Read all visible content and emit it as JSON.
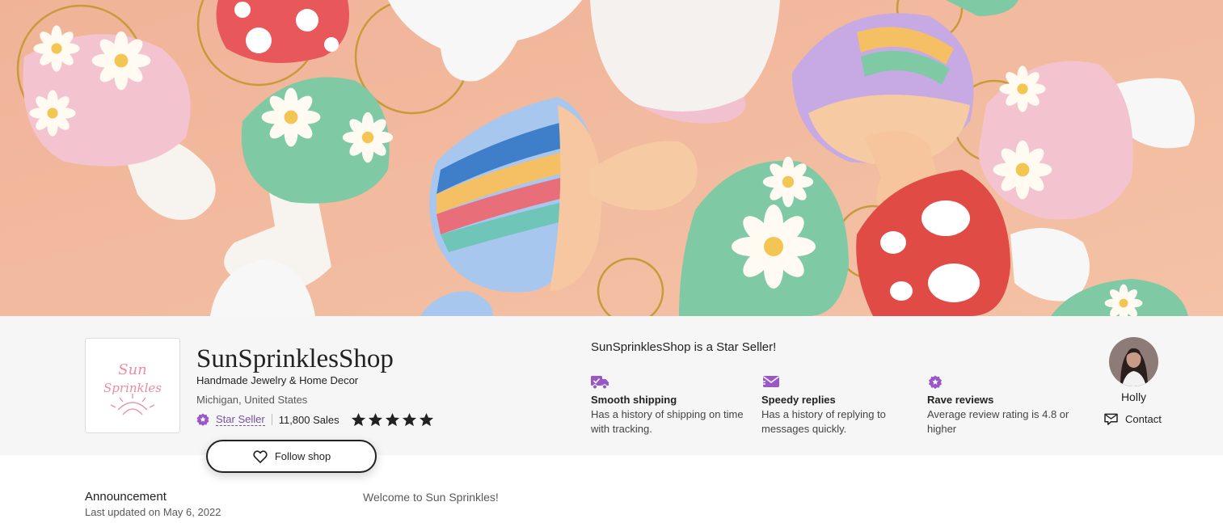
{
  "banner": {
    "alt": "Colorful clay mushroom earrings on a peach background"
  },
  "shop": {
    "logo_text_line1": "Sun",
    "logo_text_line2": "Sprinkles",
    "name": "SunSprinklesShop",
    "tagline": "Handmade Jewelry & Home Decor",
    "location": "Michigan, United States",
    "star_seller_label": "Star Seller",
    "sales": "11,800 Sales",
    "rating": 5,
    "rating_max": 5,
    "follow_label": "Follow shop"
  },
  "star_seller": {
    "headline": "SunSprinklesShop is a Star Seller!",
    "perks": [
      {
        "icon": "truck-icon",
        "title": "Smooth shipping",
        "desc": "Has a history of shipping on time with tracking."
      },
      {
        "icon": "envelope-icon",
        "title": "Speedy replies",
        "desc": "Has a history of replying to messages quickly."
      },
      {
        "icon": "star-badge-icon",
        "title": "Rave reviews",
        "desc": "Average review rating is 4.8 or higher"
      }
    ]
  },
  "owner": {
    "name": "Holly",
    "contact_label": "Contact"
  },
  "announcement": {
    "title": "Announcement",
    "updated": "Last updated on May 6, 2022",
    "message": "Welcome to Sun Sprinkles!"
  },
  "colors": {
    "accent_purple": "#7b4fa3",
    "perk_icon_purple": "#9a57c7",
    "banner_bg": "#f2b79d",
    "strip_bg": "#f6f6f6"
  }
}
